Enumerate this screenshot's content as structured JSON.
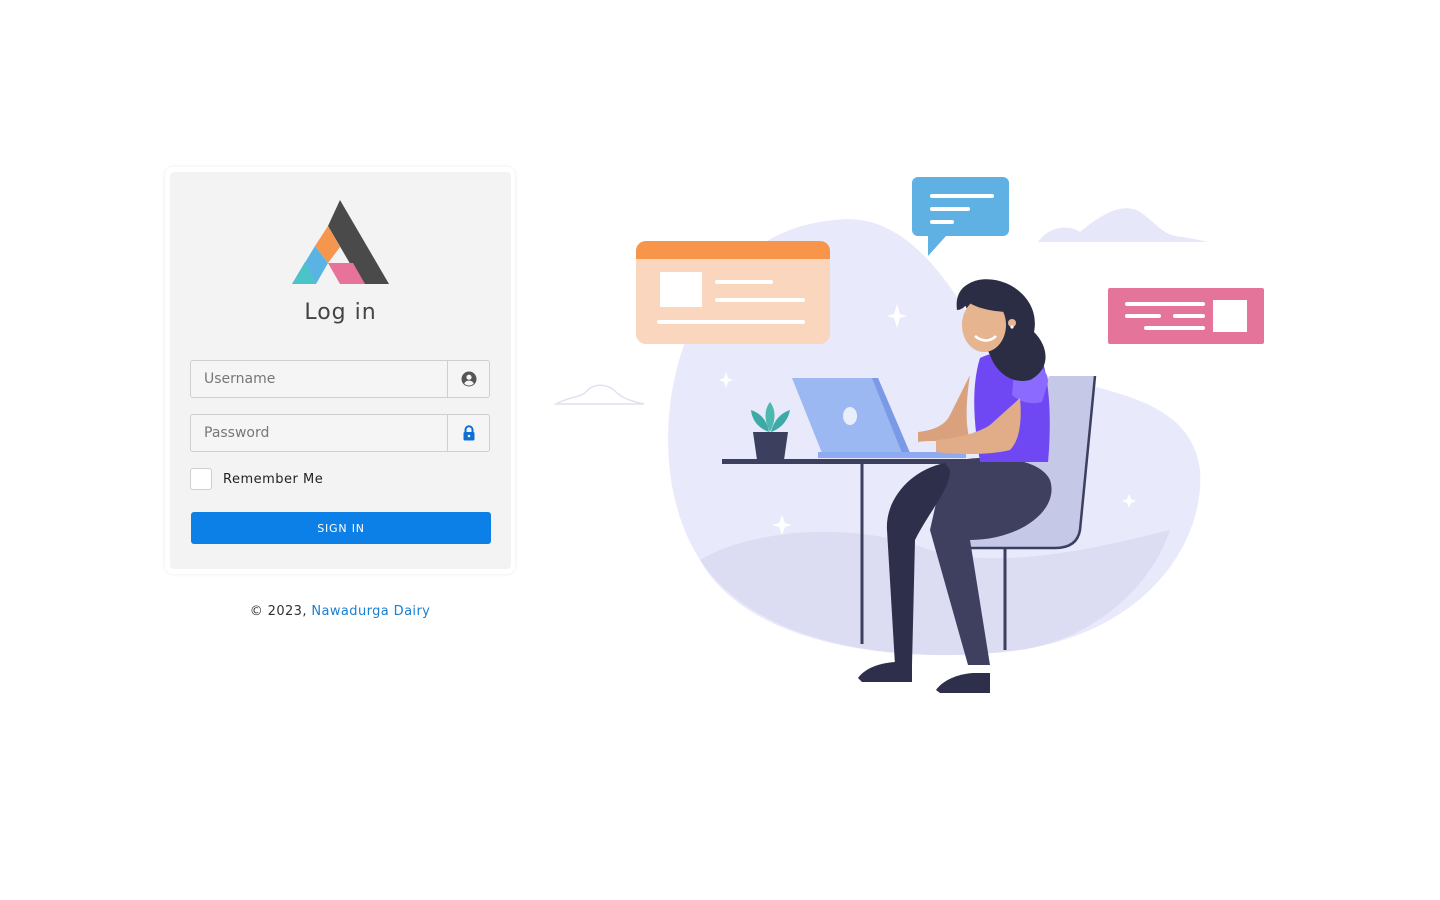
{
  "login": {
    "title": "Log in",
    "username_placeholder": "Username",
    "password_placeholder": "Password",
    "remember_label": "Remember Me",
    "signin_label": "SIGN IN"
  },
  "footer": {
    "copyright": "© 2023, ",
    "company": "Nawadurga Dairy"
  },
  "icons": {
    "username_field": "user-circle-icon",
    "password_field": "lock-icon"
  },
  "colors": {
    "primary": "#0d80e8",
    "link": "#1a7fcf",
    "card_bg": "#f3f3f3"
  }
}
